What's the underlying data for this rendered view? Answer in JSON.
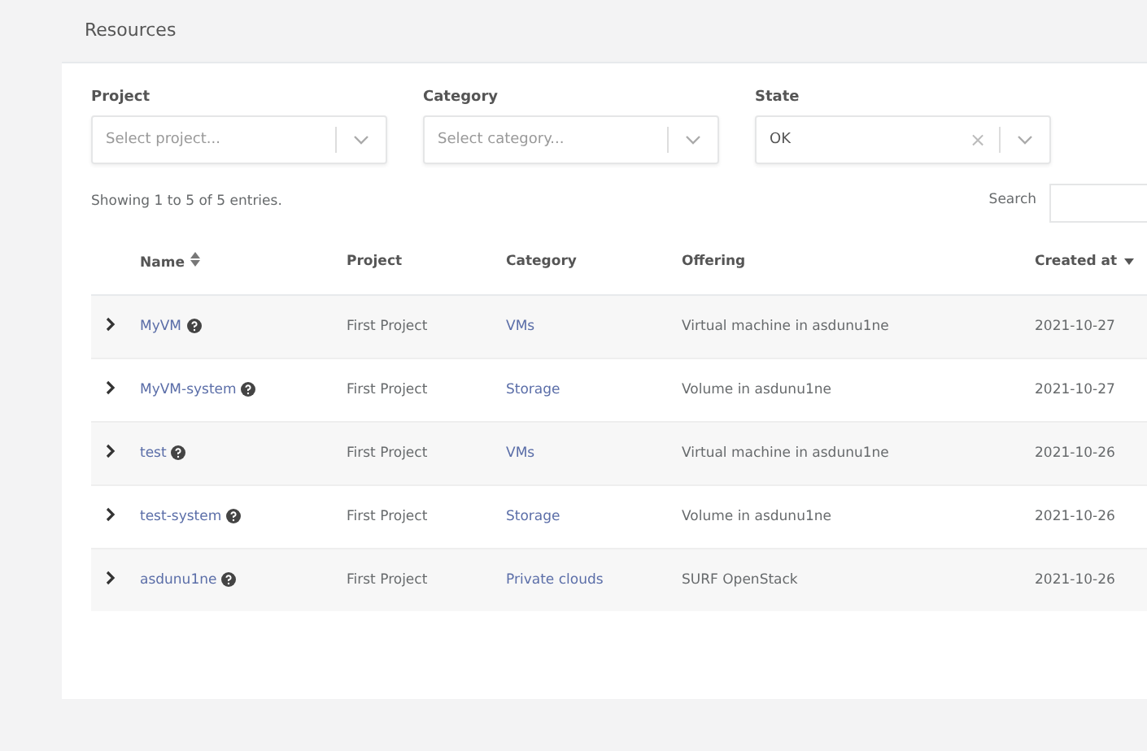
{
  "page_title": "Resources",
  "filters": [
    {
      "label": "Project",
      "placeholder": "Select project...",
      "clearable": false
    },
    {
      "label": "Category",
      "placeholder": "Select category...",
      "clearable": false
    },
    {
      "label": "State",
      "value": "OK",
      "clearable": true
    }
  ],
  "clear_glyph": "×",
  "summary": "Showing 1 to 5 of 5 entries.",
  "search": {
    "label": "Search"
  },
  "table": {
    "columns": [
      {
        "label": "Name",
        "kind": "sortable"
      },
      {
        "label": "Project",
        "kind": "plain"
      },
      {
        "label": "Category",
        "kind": "plain"
      },
      {
        "label": "Offering",
        "kind": "plain"
      },
      {
        "label": "Created at",
        "kind": "descending"
      }
    ],
    "rows": [
      {
        "name": "MyVM",
        "project": "First Project",
        "category": "VMs",
        "offering": "Virtual machine in asdunu1ne",
        "created": "2021-10-27",
        "expanded": false
      },
      {
        "name": "MyVM-system",
        "project": "First Project",
        "category": "Storage",
        "offering": "Volume in asdunu1ne",
        "created": "2021-10-27",
        "expanded": false
      },
      {
        "name": "test",
        "project": "First Project",
        "category": "VMs",
        "offering": "Virtual machine in asdunu1ne",
        "created": "2021-10-26",
        "expanded": false
      },
      {
        "name": "test-system",
        "project": "First Project",
        "category": "Storage",
        "offering": "Volume in asdunu1ne",
        "created": "2021-10-26",
        "expanded": false
      },
      {
        "name": "asdunu1ne",
        "project": "First Project",
        "category": "Private clouds",
        "offering": "SURF OpenStack",
        "created": "2021-10-26",
        "expanded": false
      }
    ]
  }
}
